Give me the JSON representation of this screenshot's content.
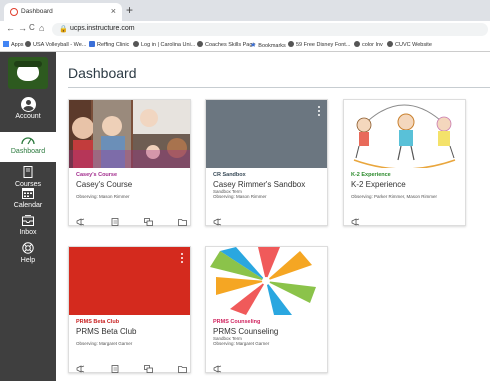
{
  "browser": {
    "tab_title": "Dashboard",
    "tab_close": "×",
    "new_tab": "+",
    "back": "←",
    "forward": "→",
    "reload": "C",
    "home": "⌂",
    "url": "ucps.instructure.com",
    "bookmarks": [
      {
        "label": "Apps",
        "icon": "apps-grid-icon"
      },
      {
        "label": "USA Volleyball - We...",
        "icon": "globe-icon"
      },
      {
        "label": "Reffing Clinic",
        "icon": "doc-icon"
      },
      {
        "label": "Log in | Carolina Uni...",
        "icon": "globe-icon"
      },
      {
        "label": "Coaches Skills Page",
        "icon": "globe-icon"
      },
      {
        "label": "Bookmarks",
        "icon": "star-icon"
      },
      {
        "label": "59 Free Disney Font...",
        "icon": "globe-icon"
      },
      {
        "label": "color Inv",
        "icon": "globe-icon"
      },
      {
        "label": "CUVC Website",
        "icon": "globe-icon"
      }
    ]
  },
  "nav": {
    "account": "Account",
    "dashboard": "Dashboard",
    "courses": "Courses",
    "calendar": "Calendar",
    "inbox": "Inbox",
    "help": "Help"
  },
  "page": {
    "title": "Dashboard"
  },
  "cards": [
    {
      "code": "Casey's Course",
      "name": "Casey's Course",
      "term": "",
      "observing": "Observing: Mason Rimmer",
      "code_color": "#a12a8c"
    },
    {
      "code": "CR Sandbox",
      "name": "Casey Rimmer's Sandbox",
      "term": "Sandbox Term",
      "observing": "Observing: Mason Rimmer",
      "code_color": "#394b58"
    },
    {
      "code": "K-2 Experience",
      "name": "K-2 Experience",
      "term": "",
      "observing": "Observing: Parker Rimmer, Mason Rimmer",
      "code_color": "#2a8a2a"
    },
    {
      "code": "PRMS Beta Club",
      "name": "PRMS Beta Club",
      "term": "",
      "observing": "Observing: Margaret Garner",
      "code_color": "#c82020"
    },
    {
      "code": "PRMS Counseling",
      "name": "PRMS Counseling",
      "term": "Sandbox Term",
      "observing": "Observing: Margaret Garner",
      "code_color": "#d0245f"
    }
  ],
  "colors": {
    "sidebar": "#3f3f3f",
    "sandbox_hero": "#6b7680",
    "beta_hero": "#d42a1e",
    "active_nav": "#2c7a3e"
  }
}
